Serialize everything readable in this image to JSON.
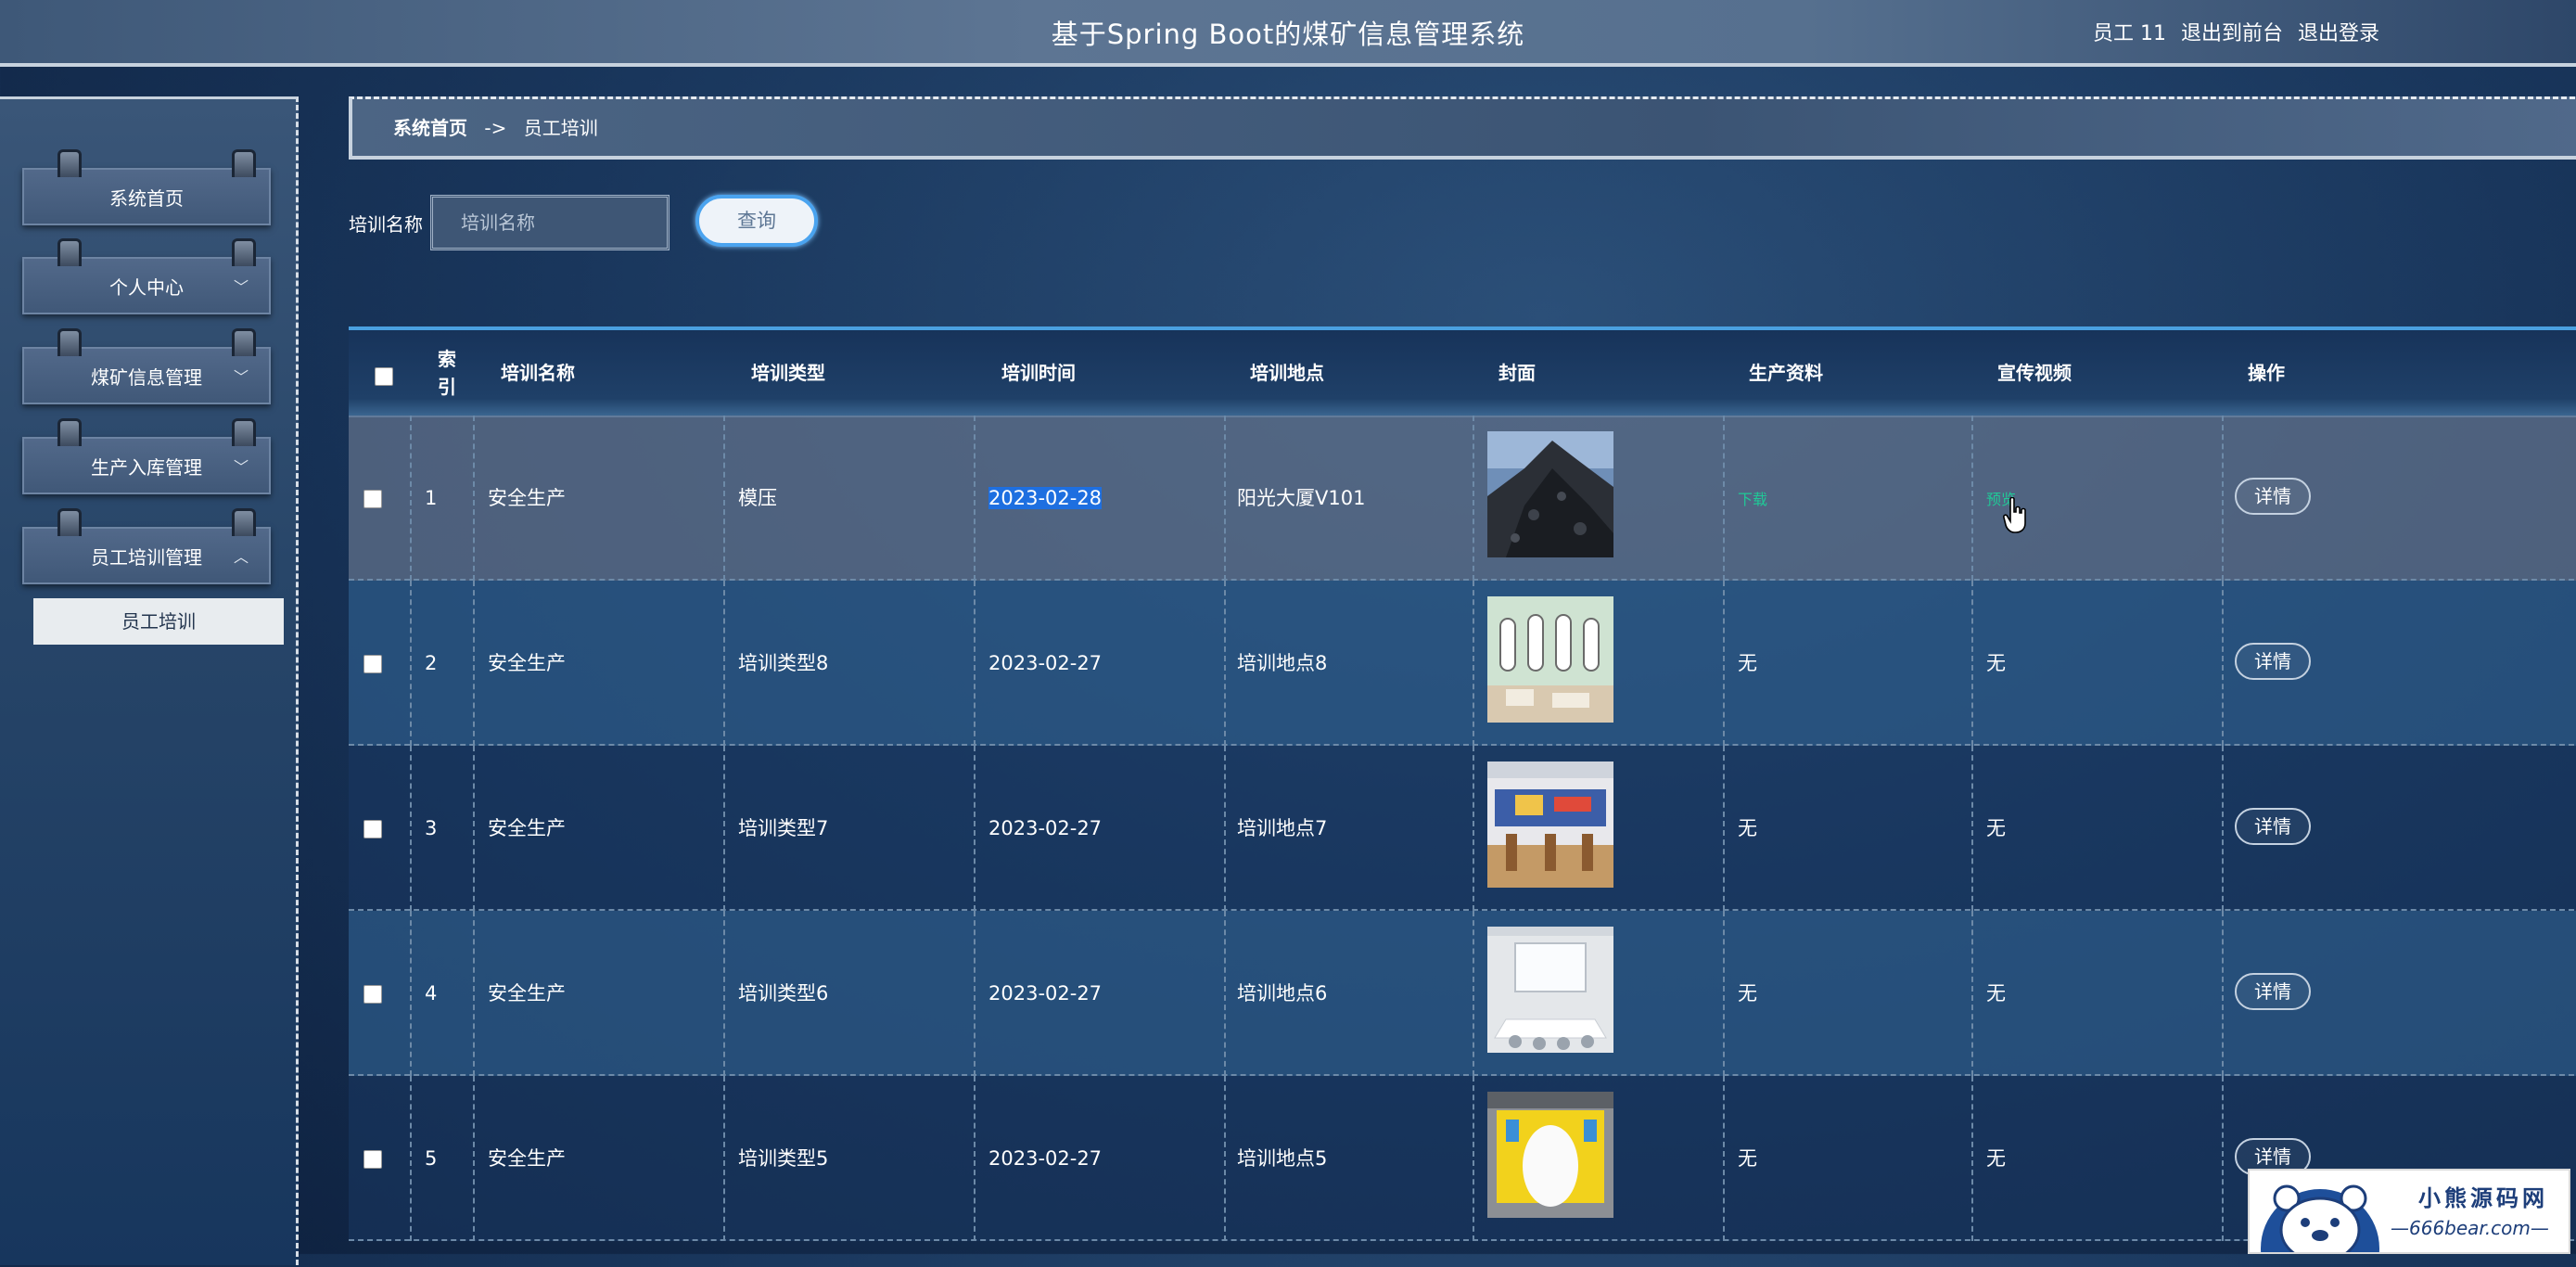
{
  "header": {
    "title": "基于Spring Boot的煤矿信息管理系统",
    "user": "员工 11",
    "back_to_front": "退出到前台",
    "logout": "退出登录"
  },
  "sidebar": {
    "items": [
      {
        "label": "系统首页",
        "has_chevron": false
      },
      {
        "label": "个人中心",
        "has_chevron": true,
        "chevron": "chevron-down-icon"
      },
      {
        "label": "煤矿信息管理",
        "has_chevron": true,
        "chevron": "chevron-down-icon"
      },
      {
        "label": "生产入库管理",
        "has_chevron": true,
        "chevron": "chevron-down-icon"
      },
      {
        "label": "员工培训管理",
        "has_chevron": true,
        "chevron": "chevron-up-icon"
      }
    ],
    "submenu": [
      "员工培训"
    ]
  },
  "breadcrumb": {
    "home": "系统首页",
    "separator": "->",
    "current": "员工培训"
  },
  "search": {
    "label": "培训名称",
    "placeholder": "培训名称",
    "button": "查询"
  },
  "table": {
    "headers": [
      "索引",
      "培训名称",
      "培训类型",
      "培训时间",
      "培训地点",
      "封面",
      "生产资料",
      "宣传视频",
      "操作"
    ],
    "rows": [
      {
        "index": "1",
        "name": "安全生产",
        "type": "模压",
        "time": "2023-02-28",
        "place": "阳光大厦V101",
        "cover": "coal-pile-image",
        "material": "下载",
        "video": "预览",
        "action": "详情"
      },
      {
        "index": "2",
        "name": "安全生产",
        "type": "培训类型8",
        "time": "2023-02-27",
        "place": "培训地点8",
        "cover": "classroom-image",
        "material": "无",
        "video": "无",
        "action": "详情"
      },
      {
        "index": "3",
        "name": "安全生产",
        "type": "培训类型7",
        "time": "2023-02-27",
        "place": "培训地点7",
        "cover": "training-room-image",
        "material": "无",
        "video": "无",
        "action": "详情"
      },
      {
        "index": "4",
        "name": "安全生产",
        "type": "培训类型6",
        "time": "2023-02-27",
        "place": "培训地点6",
        "cover": "meeting-room-image",
        "material": "无",
        "video": "无",
        "action": "详情"
      },
      {
        "index": "5",
        "name": "安全生产",
        "type": "培训类型5",
        "time": "2023-02-27",
        "place": "培训地点5",
        "cover": "yellow-room-image",
        "material": "无",
        "video": "无",
        "action": "详情"
      }
    ]
  },
  "watermark": {
    "title": "小熊源码网",
    "url": "—666bear.com—"
  },
  "colors": {
    "accent_blue": "#4aa3ef",
    "link_green": "#20c997",
    "selection": "#1e6fe0"
  }
}
